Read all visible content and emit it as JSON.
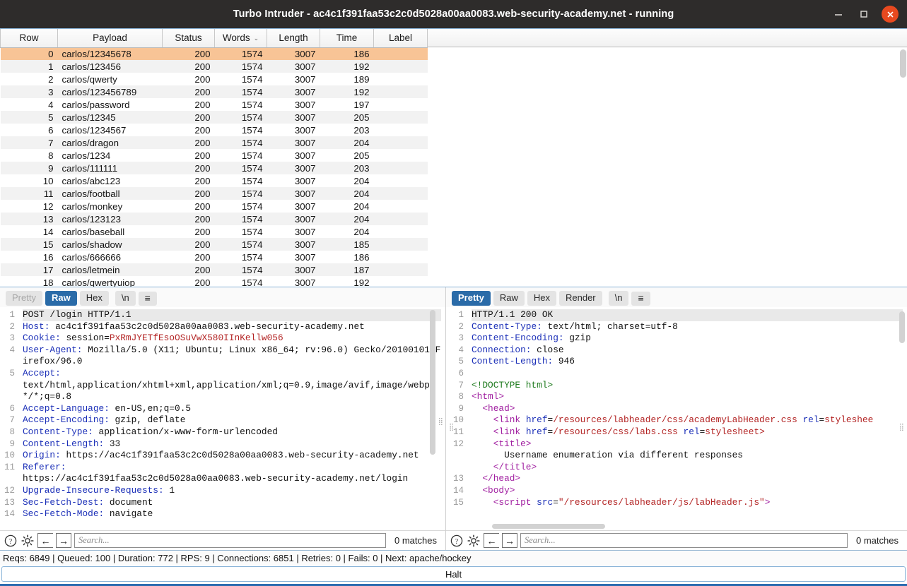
{
  "window": {
    "title": "Turbo Intruder - ac4c1f391faa53c2c0d5028a00aa0083.web-security-academy.net - running",
    "minimize_label": "minimize-icon",
    "maximize_label": "maximize-icon",
    "close_label": "close-icon",
    "accent_close": "#e8491f",
    "titlebar_bg": "#2e2c2b"
  },
  "results_table": {
    "columns": [
      "Row",
      "Payload",
      "Status",
      "Words",
      "Length",
      "Time",
      "Label"
    ],
    "sorted_column": "Words",
    "sort_glyph": "⌄",
    "selected_row_color": "#f8c496",
    "rows": [
      {
        "row": "0",
        "payload": "carlos/12345678",
        "status": "200",
        "words": "1574",
        "length": "3007",
        "time": "186",
        "label": ""
      },
      {
        "row": "1",
        "payload": "carlos/123456",
        "status": "200",
        "words": "1574",
        "length": "3007",
        "time": "192",
        "label": ""
      },
      {
        "row": "2",
        "payload": "carlos/qwerty",
        "status": "200",
        "words": "1574",
        "length": "3007",
        "time": "189",
        "label": ""
      },
      {
        "row": "3",
        "payload": "carlos/123456789",
        "status": "200",
        "words": "1574",
        "length": "3007",
        "time": "192",
        "label": ""
      },
      {
        "row": "4",
        "payload": "carlos/password",
        "status": "200",
        "words": "1574",
        "length": "3007",
        "time": "197",
        "label": ""
      },
      {
        "row": "5",
        "payload": "carlos/12345",
        "status": "200",
        "words": "1574",
        "length": "3007",
        "time": "205",
        "label": ""
      },
      {
        "row": "6",
        "payload": "carlos/1234567",
        "status": "200",
        "words": "1574",
        "length": "3007",
        "time": "203",
        "label": ""
      },
      {
        "row": "7",
        "payload": "carlos/dragon",
        "status": "200",
        "words": "1574",
        "length": "3007",
        "time": "204",
        "label": ""
      },
      {
        "row": "8",
        "payload": "carlos/1234",
        "status": "200",
        "words": "1574",
        "length": "3007",
        "time": "205",
        "label": ""
      },
      {
        "row": "9",
        "payload": "carlos/111111",
        "status": "200",
        "words": "1574",
        "length": "3007",
        "time": "203",
        "label": ""
      },
      {
        "row": "10",
        "payload": "carlos/abc123",
        "status": "200",
        "words": "1574",
        "length": "3007",
        "time": "204",
        "label": ""
      },
      {
        "row": "11",
        "payload": "carlos/football",
        "status": "200",
        "words": "1574",
        "length": "3007",
        "time": "204",
        "label": ""
      },
      {
        "row": "12",
        "payload": "carlos/monkey",
        "status": "200",
        "words": "1574",
        "length": "3007",
        "time": "204",
        "label": ""
      },
      {
        "row": "13",
        "payload": "carlos/123123",
        "status": "200",
        "words": "1574",
        "length": "3007",
        "time": "204",
        "label": ""
      },
      {
        "row": "14",
        "payload": "carlos/baseball",
        "status": "200",
        "words": "1574",
        "length": "3007",
        "time": "204",
        "label": ""
      },
      {
        "row": "15",
        "payload": "carlos/shadow",
        "status": "200",
        "words": "1574",
        "length": "3007",
        "time": "185",
        "label": ""
      },
      {
        "row": "16",
        "payload": "carlos/666666",
        "status": "200",
        "words": "1574",
        "length": "3007",
        "time": "186",
        "label": ""
      },
      {
        "row": "17",
        "payload": "carlos/letmein",
        "status": "200",
        "words": "1574",
        "length": "3007",
        "time": "187",
        "label": ""
      },
      {
        "row": "18",
        "payload": "carlos/qwertyuiop",
        "status": "200",
        "words": "1574",
        "length": "3007",
        "time": "192",
        "label": ""
      }
    ],
    "selected_index": 0
  },
  "request_panel": {
    "tabs": [
      {
        "label": "Pretty",
        "state": "ghost"
      },
      {
        "label": "Raw",
        "state": "active"
      },
      {
        "label": "Hex",
        "state": "normal"
      },
      {
        "label": "\\n",
        "state": "normal"
      },
      {
        "label": "≡",
        "state": "normal"
      }
    ],
    "lines": [
      {
        "n": "1",
        "text": "POST /login HTTP/1.1"
      },
      {
        "n": "2",
        "key": "Host",
        "text": " ac4c1f391faa53c2c0d5028a00aa0083.web-security-academy.net"
      },
      {
        "n": "3",
        "key": "Cookie",
        "text": " session=",
        "cookie_value": "PxRmJYETfEsoOSuVwX580IInKellw056"
      },
      {
        "n": "4",
        "key": "User-Agent",
        "text": " Mozilla/5.0 (X11; Ubuntu; Linux x86_64; rv:96.0) Gecko/20100101 Firefox/96.0"
      },
      {
        "n": "5",
        "key": "Accept",
        "text": "\ntext/html,application/xhtml+xml,application/xml;q=0.9,image/avif,image/webp,*/*;q=0.8"
      },
      {
        "n": "6",
        "key": "Accept-Language",
        "text": " en-US,en;q=0.5"
      },
      {
        "n": "7",
        "key": "Accept-Encoding",
        "text": " gzip, deflate"
      },
      {
        "n": "8",
        "key": "Content-Type",
        "text": " application/x-www-form-urlencoded"
      },
      {
        "n": "9",
        "key": "Content-Length",
        "text": " 33"
      },
      {
        "n": "10",
        "key": "Origin",
        "text": " https://ac4c1f391faa53c2c0d5028a00aa0083.web-security-academy.net"
      },
      {
        "n": "11",
        "key": "Referer",
        "text": "\nhttps://ac4c1f391faa53c2c0d5028a00aa0083.web-security-academy.net/login"
      },
      {
        "n": "12",
        "key": "Upgrade-Insecure-Requests",
        "text": " 1"
      },
      {
        "n": "13",
        "key": "Sec-Fetch-Dest",
        "text": " document"
      },
      {
        "n": "14",
        "key": "Sec-Fetch-Mode",
        "text": " navigate"
      }
    ],
    "search": {
      "placeholder": "Search...",
      "matches": "0 matches"
    },
    "toolbar_icons": [
      "help-icon",
      "gear-icon",
      "prev-icon",
      "next-icon"
    ]
  },
  "response_panel": {
    "tabs": [
      {
        "label": "Pretty",
        "state": "active"
      },
      {
        "label": "Raw",
        "state": "normal"
      },
      {
        "label": "Hex",
        "state": "normal"
      },
      {
        "label": "Render",
        "state": "normal"
      },
      {
        "label": "\\n",
        "state": "normal"
      },
      {
        "label": "≡",
        "state": "normal"
      }
    ],
    "lines": [
      {
        "n": "1",
        "type": "status",
        "text": "HTTP/1.1 200 OK"
      },
      {
        "n": "2",
        "type": "header",
        "key": "Content-Type",
        "text": " text/html; charset=utf-8"
      },
      {
        "n": "3",
        "type": "header",
        "key": "Content-Encoding",
        "text": " gzip"
      },
      {
        "n": "4",
        "type": "header",
        "key": "Connection",
        "text": " close"
      },
      {
        "n": "5",
        "type": "header",
        "key": "Content-Length",
        "text": " 946"
      },
      {
        "n": "6",
        "type": "blank",
        "text": ""
      },
      {
        "n": "7",
        "type": "doctype",
        "text": "<!DOCTYPE html>"
      },
      {
        "n": "8",
        "type": "tag",
        "text": "<html>"
      },
      {
        "n": "9",
        "type": "tag",
        "indent": 1,
        "text": "<head>"
      },
      {
        "n": "10",
        "type": "link",
        "indent": 2,
        "tag": "link",
        "attr1": "href",
        "val1": "/resources/labheader/css/academyLabHeader.css",
        "attr2": "rel",
        "val2": "styleshee"
      },
      {
        "n": "11",
        "type": "link",
        "indent": 2,
        "tag": "link",
        "attr1": "href",
        "val1": "/resources/css/labs.css",
        "attr2": "rel",
        "val2": "stylesheet>"
      },
      {
        "n": "12",
        "type": "title",
        "indent": 2,
        "open": "<title>",
        "content": "Username enumeration via different responses",
        "close": "</title>"
      },
      {
        "n": "13",
        "type": "tag",
        "indent": 1,
        "text": "</head>"
      },
      {
        "n": "14",
        "type": "tag",
        "indent": 1,
        "text": "<body>"
      },
      {
        "n": "15",
        "type": "script",
        "indent": 2,
        "open": "<script ",
        "attr": "src",
        "val": "\"/resources/labheader/js/labHeader.js\"",
        "close": ">"
      }
    ],
    "search": {
      "placeholder": "Search...",
      "matches": "0 matches"
    },
    "toolbar_icons": [
      "help-icon",
      "gear-icon",
      "prev-icon",
      "next-icon"
    ]
  },
  "status_bar": {
    "text": "Reqs: 6849 | Queued: 100 | Duration: 772 | RPS: 9 | Connections: 6851 | Retries: 0 | Fails: 0 | Next: apache/hockey"
  },
  "halt_button": {
    "label": "Halt"
  }
}
